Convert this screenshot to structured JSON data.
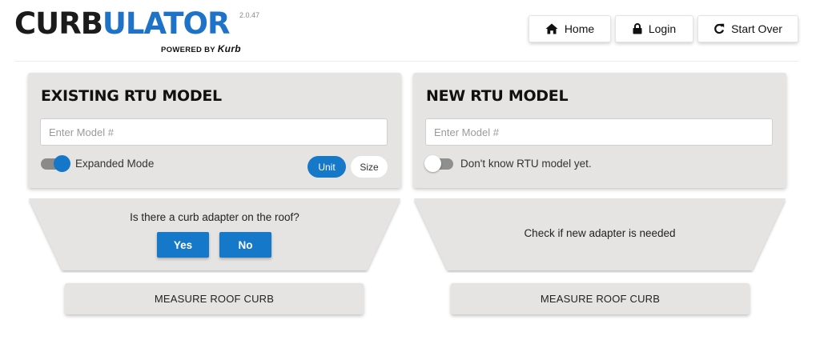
{
  "header": {
    "logo_part1": "CURB",
    "logo_part2": "ULATOR",
    "version": "2.0.47",
    "powered_by": "POWERED BY",
    "powered_brand": "Kurb",
    "nav": [
      {
        "label": "Home",
        "icon": "home-icon"
      },
      {
        "label": "Login",
        "icon": "lock-icon"
      },
      {
        "label": "Start Over",
        "icon": "redo-icon"
      }
    ]
  },
  "existing": {
    "title": "EXISTING RTU MODEL",
    "input_value": "",
    "input_placeholder": "Enter Model #",
    "toggle_label": "Expanded Mode",
    "toggle_on": true,
    "search_modes": [
      "Unit",
      "Size"
    ],
    "active_mode": "Unit",
    "question": "Is there a curb adapter on the roof?",
    "yes_label": "Yes",
    "no_label": "No",
    "measure_label": "MEASURE ROOF CURB"
  },
  "new": {
    "title": "NEW RTU MODEL",
    "input_value": "",
    "input_placeholder": "Enter Model #",
    "toggle_label": "Don't know RTU model yet.",
    "toggle_on": false,
    "message": "Check if new adapter is needed",
    "measure_label": "MEASURE ROOF CURB"
  },
  "colors": {
    "accent": "#1578c8",
    "panel": "#e6e4e3",
    "logo_blue": "#1e73c8"
  }
}
